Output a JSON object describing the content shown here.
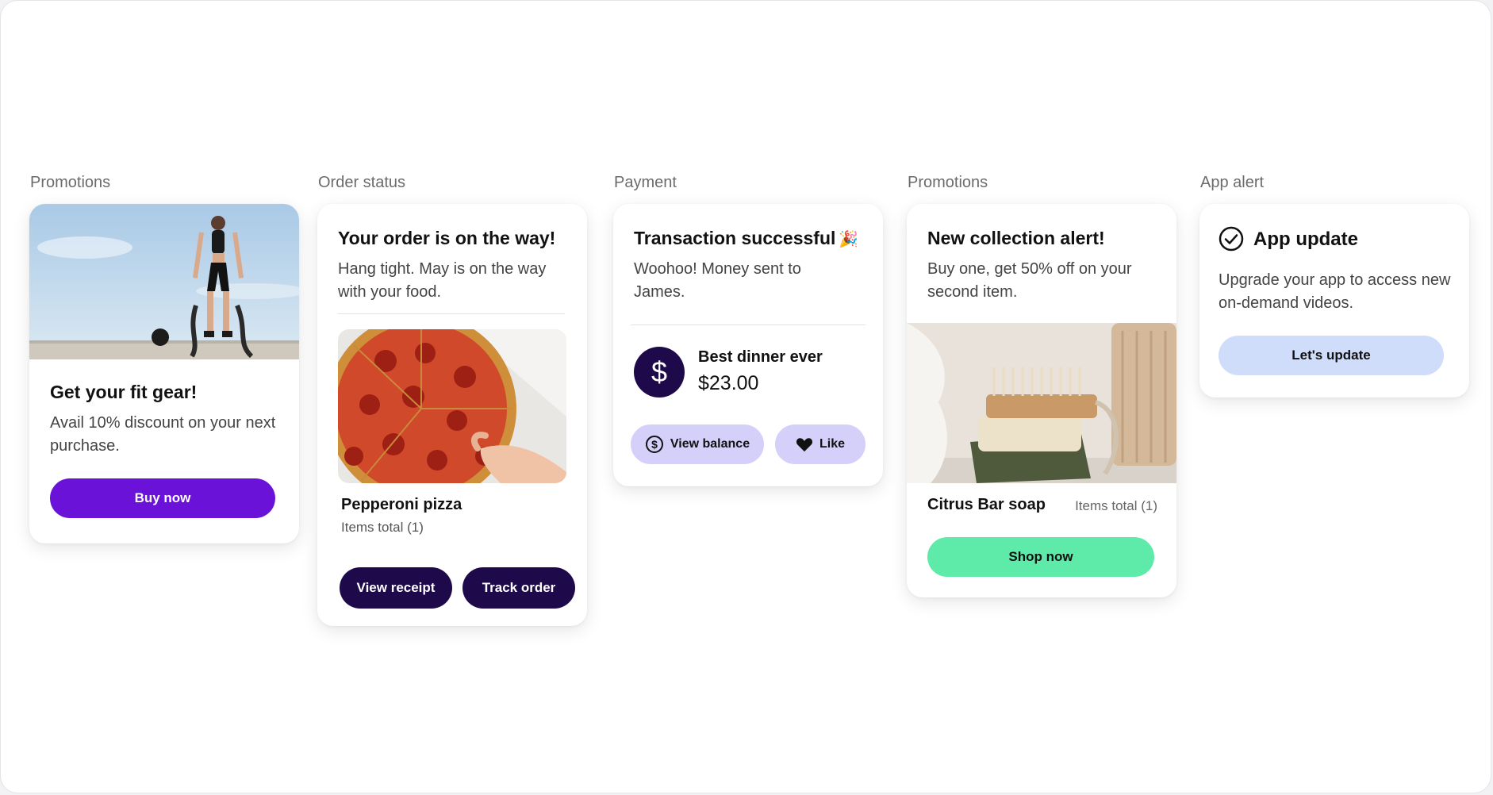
{
  "colors": {
    "purple": "#6a12d8",
    "navy": "#1e0a4a",
    "lavender": "#d4d0fa",
    "mint": "#5eeaa9",
    "blue_pale": "#cfdcfa"
  },
  "promo1": {
    "category": "Promotions",
    "image": "woman-with-battle-ropes-photo",
    "title": "Get your fit gear!",
    "body": "Avail 10% discount on your next purchase.",
    "button": "Buy now"
  },
  "order": {
    "category": "Order status",
    "title": "Your order is on the way!",
    "body": "Hang tight. May is on the way with your food.",
    "image": "pepperoni-pizza-photo",
    "item_name": "Pepperoni pizza",
    "items_total": "Items total (1)",
    "receipt_button": "View receipt",
    "track_button": "Track order"
  },
  "payment": {
    "category": "Payment",
    "title": "Transaction successful",
    "title_emoji": "🎉",
    "body": "Woohoo! Money sent to James.",
    "avatar_icon": "dollar-icon",
    "note": "Best dinner ever",
    "amount": "$23.00",
    "balance_button": "View balance",
    "like_button": "Like"
  },
  "promo2": {
    "category": "Promotions",
    "title": "New collection alert!",
    "body": "Buy one, get 50% off on your second item.",
    "image": "soap-and-brush-photo",
    "item_name": "Citrus Bar soap",
    "items_total": "Items total (1)",
    "button": "Shop now"
  },
  "alert": {
    "category": "App alert",
    "icon": "check-circle-icon",
    "title": "App update",
    "body": "Upgrade your app to access new on-demand videos.",
    "button": "Let's update"
  }
}
